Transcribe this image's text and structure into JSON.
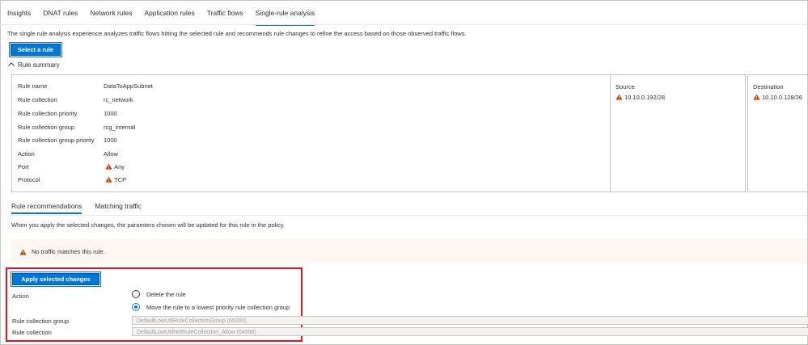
{
  "tabs": [
    "Insights",
    "DNAT rules",
    "Network rules",
    "Application rules",
    "Traffic flows",
    "Single-rule analysis"
  ],
  "active_tab": "Single-rule analysis",
  "description": "The single rule analysis experience analyzes traffic flows hitting the selected rule and recommends rule changes to refine the access based on those observed traffic flows.",
  "select_rule_label": "Select a rule",
  "rule_summary_label": "Rule summary",
  "summary": {
    "rows": [
      {
        "key": "Rule name",
        "value": "DataToAppSubnet",
        "warn": false
      },
      {
        "key": "Rule collection",
        "value": "rc_network",
        "warn": false
      },
      {
        "key": "Rule collection priority",
        "value": "1000",
        "warn": false
      },
      {
        "key": "Rule collection group",
        "value": "rcg_internal",
        "warn": false
      },
      {
        "key": "Rule collection group priority",
        "value": "1000",
        "warn": false
      },
      {
        "key": "Action",
        "value": "Allow",
        "warn": false
      },
      {
        "key": "Port",
        "value": "Any",
        "warn": true
      },
      {
        "key": "Protocol",
        "value": "TCP",
        "warn": true
      }
    ],
    "source": {
      "label": "Source",
      "value": "10.10.0.192/28"
    },
    "destination": {
      "label": "Destination",
      "value": "10.10.0.128/26"
    }
  },
  "subtabs": [
    "Rule recommendations",
    "Matching traffic"
  ],
  "active_subtab": "Rule recommendations",
  "note": "When you apply the selected changes, the paramters chosen will be updated for this rule in the policy.",
  "banner_text": "No traffic matches this rule.",
  "apply_label": "Apply selected changes",
  "action_label": "Action",
  "radio_options": [
    {
      "label": "Delete the rule",
      "checked": false
    },
    {
      "label": "Move the rule to a lowest priority rule collection group",
      "checked": true
    }
  ],
  "rcg_label": "Rule collection group",
  "rcg_value": "DefaultLowUtilRuleCollectionGroup (65000)",
  "rc_label": "Rule collection",
  "rc_value": "DefaultLowUtilNetRuleCollection_Allow (64998)",
  "colors": {
    "accent": "#0078d4",
    "warning": "#d83b01",
    "highlight_border": "#e81123",
    "banner_bg": "#fdf6f1"
  }
}
